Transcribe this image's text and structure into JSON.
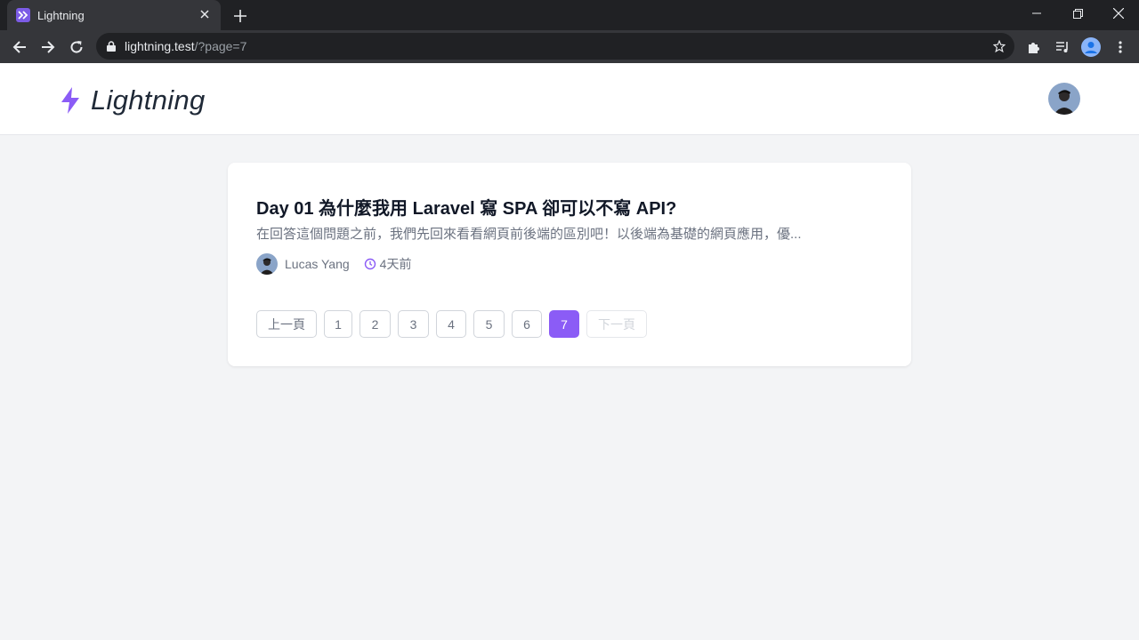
{
  "browser": {
    "tab_title": "Lightning",
    "url_host": "lightning.test",
    "url_path": "/?page=7"
  },
  "site": {
    "logo_text": "Lightning"
  },
  "post": {
    "title": "Day 01 為什麼我用 Laravel 寫 SPA 卻可以不寫 API?",
    "excerpt": "在回答這個問題之前，我們先回來看看網頁前後端的區別吧！以後端為基礎的網頁應用，優...",
    "author": "Lucas Yang",
    "time": "4天前"
  },
  "pagination": {
    "prev_label": "上一頁",
    "next_label": "下一頁",
    "pages": [
      "1",
      "2",
      "3",
      "4",
      "5",
      "6",
      "7"
    ],
    "current": "7"
  },
  "colors": {
    "accent": "#8b5cf6",
    "browser_dark": "#202124",
    "browser_toolbar": "#35363a"
  }
}
